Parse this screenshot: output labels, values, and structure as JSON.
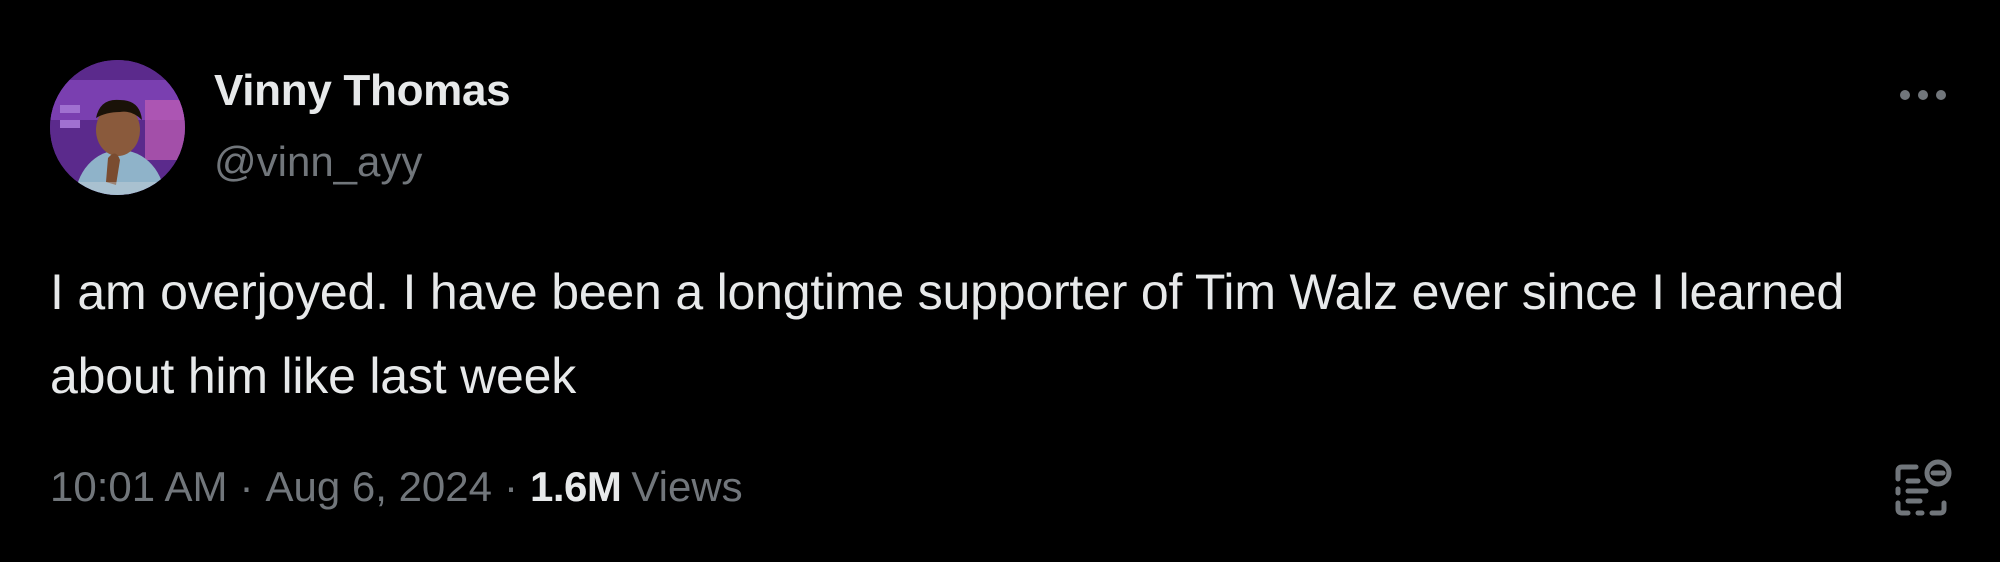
{
  "author": {
    "display_name": "Vinny Thomas",
    "handle": "@vinn_ayy",
    "avatar_icon": "profile-photo-avatar"
  },
  "tweet": {
    "text": "I am overjoyed. I have been a longtime supporter of Tim Walz ever since I learned about him like last week"
  },
  "meta": {
    "time": "10:01 AM",
    "separator": "·",
    "date": "Aug 6, 2024",
    "views_count": "1.6M",
    "views_label": "Views"
  },
  "icons": {
    "more": "more-dots-icon",
    "analytics": "analytics-icon"
  },
  "colors": {
    "background": "#000000",
    "primary_text": "#e7e9ea",
    "secondary_text": "#71767b",
    "avatar_bg": "#5b2a8c"
  }
}
